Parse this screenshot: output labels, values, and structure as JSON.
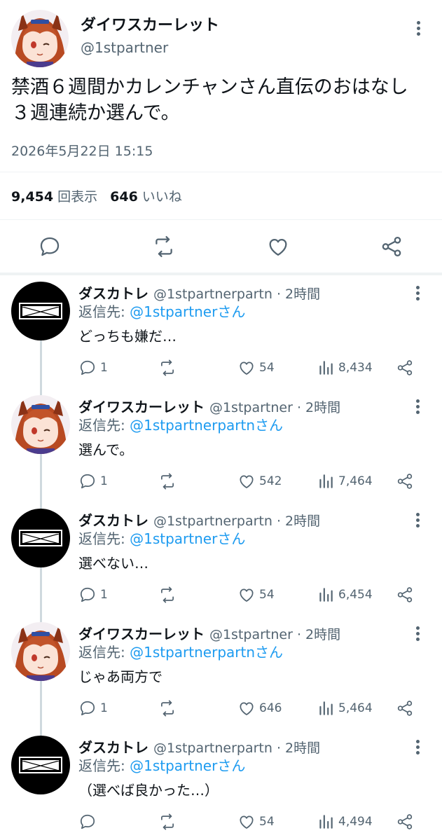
{
  "main_tweet": {
    "display_name": "ダイワスカーレット",
    "handle": "@1stpartner",
    "text": "禁酒６週間かカレンチャンさん直伝のおはなし\n３週連続か選んで。",
    "timestamp": "2026年5月22日 15:15",
    "views_count": "9,454",
    "views_label": "回表示",
    "likes_count": "646",
    "likes_label": "いいね",
    "icons": [
      "reply-icon",
      "retweet-icon",
      "like-icon",
      "share-icon",
      "more-icon"
    ]
  },
  "replies": [
    {
      "display_name": "ダスカトレ",
      "meta": "@1stpartnerpartn · 2時間",
      "reply_to_label": "返信先: ",
      "reply_to_mention": "@1stpartnerさん",
      "text": "どっちも嫌だ…",
      "reply_count": "1",
      "like_count": "54",
      "view_count": "8,434"
    },
    {
      "display_name": "ダイワスカーレット",
      "meta": "@1stpartner · 2時間",
      "reply_to_label": "返信先: ",
      "reply_to_mention": "@1stpartnerpartnさん",
      "text": "選んで。",
      "reply_count": "1",
      "like_count": "542",
      "view_count": "7,464"
    },
    {
      "display_name": "ダスカトレ",
      "meta": "@1stpartnerpartn · 2時間",
      "reply_to_label": "返信先: ",
      "reply_to_mention": "@1stpartnerさん",
      "text": "選べない…",
      "reply_count": "1",
      "like_count": "54",
      "view_count": "6,454"
    },
    {
      "display_name": "ダイワスカーレット",
      "meta": "@1stpartner · 2時間",
      "reply_to_label": "返信先: ",
      "reply_to_mention": "@1stpartnerpartnさん",
      "text": "じゃあ両方で",
      "reply_count": "1",
      "like_count": "646",
      "view_count": "5,464"
    },
    {
      "display_name": "ダスカトレ",
      "meta": "@1stpartnerpartn · 2時間",
      "reply_to_label": "返信先: ",
      "reply_to_mention": "@1stpartnerさん",
      "text": "（選べば良かった…）",
      "reply_count": "",
      "like_count": "54",
      "view_count": "4,494"
    }
  ],
  "colors": {
    "text": "#0f1419",
    "secondary": "#536471",
    "mention": "#1d9bf0",
    "divider": "#eff3f4",
    "thread_line": "#cfd9de",
    "avatar_hair": "#c2542a"
  }
}
